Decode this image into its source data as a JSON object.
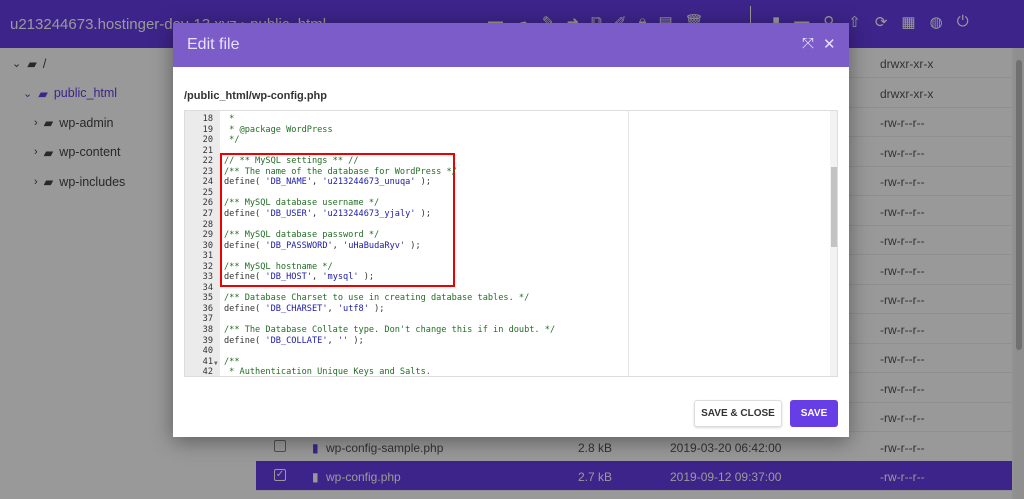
{
  "topbar": {
    "breadcrumb": "u213244673.hostinger-dev-13.xyz › public_html"
  },
  "tree": [
    {
      "label": "/",
      "icon": "folder-open-icon",
      "chevron": "⌄",
      "active": false,
      "indent": 0
    },
    {
      "label": "public_html",
      "icon": "folder-open-icon",
      "chevron": "⌄",
      "active": true,
      "indent": 1
    },
    {
      "label": "wp-admin",
      "icon": "folder-icon",
      "chevron": "›",
      "active": false,
      "indent": 2
    },
    {
      "label": "wp-content",
      "icon": "folder-icon",
      "chevron": "›",
      "active": false,
      "indent": 2
    },
    {
      "label": "wp-includes",
      "icon": "folder-icon",
      "chevron": "›",
      "active": false,
      "indent": 2
    }
  ],
  "files": [
    {
      "perm": "drwxr-xr-x"
    },
    {
      "perm": "drwxr-xr-x"
    },
    {
      "perm": "-rw-r--r--"
    },
    {
      "perm": "-rw-r--r--"
    },
    {
      "perm": "-rw-r--r--"
    },
    {
      "perm": "-rw-r--r--"
    },
    {
      "perm": "-rw-r--r--"
    },
    {
      "perm": "-rw-r--r--"
    },
    {
      "perm": "-rw-r--r--"
    },
    {
      "perm": "-rw-r--r--"
    },
    {
      "perm": "-rw-r--r--"
    },
    {
      "perm": "-rw-r--r--"
    },
    {
      "perm": "-rw-r--r--"
    },
    {
      "name": "wp-config-sample.php",
      "size": "2.8 kB",
      "date": "2019-03-20 06:42:00",
      "perm": "-rw-r--r--",
      "checked": false
    },
    {
      "name": "wp-config.php",
      "size": "2.7 kB",
      "date": "2019-09-12 09:37:00",
      "perm": "-rw-r--r--",
      "checked": true
    }
  ],
  "modal": {
    "title": "Edit file",
    "path": "/public_html/wp-config.php",
    "save_close": "SAVE & CLOSE",
    "save": "SAVE",
    "lines": [
      {
        "n": "18",
        "seg": [
          [
            " *",
            "cm"
          ]
        ]
      },
      {
        "n": "19",
        "seg": [
          [
            " * @package WordPress",
            "cm"
          ]
        ]
      },
      {
        "n": "20",
        "seg": [
          [
            " */",
            "cm"
          ]
        ]
      },
      {
        "n": "21",
        "seg": []
      },
      {
        "n": "22",
        "seg": [
          [
            "// ** MySQL settings ** //",
            "cm"
          ]
        ]
      },
      {
        "n": "23",
        "seg": [
          [
            "/** The name of the database for WordPress */",
            "cm"
          ]
        ]
      },
      {
        "n": "24",
        "seg": [
          [
            "define( ",
            ""
          ],
          [
            "'DB_NAME'",
            "st"
          ],
          [
            ", ",
            ""
          ],
          [
            "'u213244673_unuqa'",
            "st"
          ],
          [
            " );",
            ""
          ]
        ]
      },
      {
        "n": "25",
        "seg": []
      },
      {
        "n": "26",
        "seg": [
          [
            "/** MySQL database username */",
            "cm"
          ]
        ]
      },
      {
        "n": "27",
        "seg": [
          [
            "define( ",
            ""
          ],
          [
            "'DB_USER'",
            "st"
          ],
          [
            ", ",
            ""
          ],
          [
            "'u213244673_yjaly'",
            "st"
          ],
          [
            " );",
            ""
          ]
        ]
      },
      {
        "n": "28",
        "seg": []
      },
      {
        "n": "29",
        "seg": [
          [
            "/** MySQL database password */",
            "cm"
          ]
        ]
      },
      {
        "n": "30",
        "seg": [
          [
            "define( ",
            ""
          ],
          [
            "'DB_PASSWORD'",
            "st"
          ],
          [
            ", ",
            ""
          ],
          [
            "'uHaBudaRyv'",
            "st"
          ],
          [
            " );",
            ""
          ]
        ]
      },
      {
        "n": "31",
        "seg": []
      },
      {
        "n": "32",
        "seg": [
          [
            "/** MySQL hostname */",
            "cm"
          ]
        ]
      },
      {
        "n": "33",
        "seg": [
          [
            "define( ",
            ""
          ],
          [
            "'DB_HOST'",
            "st"
          ],
          [
            ", ",
            ""
          ],
          [
            "'mysql'",
            "st"
          ],
          [
            " );",
            ""
          ]
        ]
      },
      {
        "n": "34",
        "seg": []
      },
      {
        "n": "35",
        "seg": [
          [
            "/** Database Charset to use in creating database tables. */",
            "cm"
          ]
        ]
      },
      {
        "n": "36",
        "seg": [
          [
            "define( ",
            ""
          ],
          [
            "'DB_CHARSET'",
            "st"
          ],
          [
            ", ",
            ""
          ],
          [
            "'utf8'",
            "st"
          ],
          [
            " );",
            ""
          ]
        ]
      },
      {
        "n": "37",
        "seg": []
      },
      {
        "n": "38",
        "seg": [
          [
            "/** The Database Collate type. Don't change this if in doubt. */",
            "cm"
          ]
        ]
      },
      {
        "n": "39",
        "seg": [
          [
            "define( ",
            ""
          ],
          [
            "'DB_COLLATE'",
            "st"
          ],
          [
            ", ",
            ""
          ],
          [
            "''",
            "st"
          ],
          [
            " );",
            ""
          ]
        ]
      },
      {
        "n": "40",
        "seg": []
      },
      {
        "n": "41",
        "seg": [
          [
            "/**",
            "cm"
          ]
        ],
        "fold": true
      },
      {
        "n": "42",
        "seg": [
          [
            " * Authentication Unique Keys and Salts.",
            "cm"
          ]
        ]
      }
    ]
  },
  "colors": {
    "brand": "#673de6",
    "modal_header": "#7b5cc9",
    "highlight": "#e00000"
  }
}
